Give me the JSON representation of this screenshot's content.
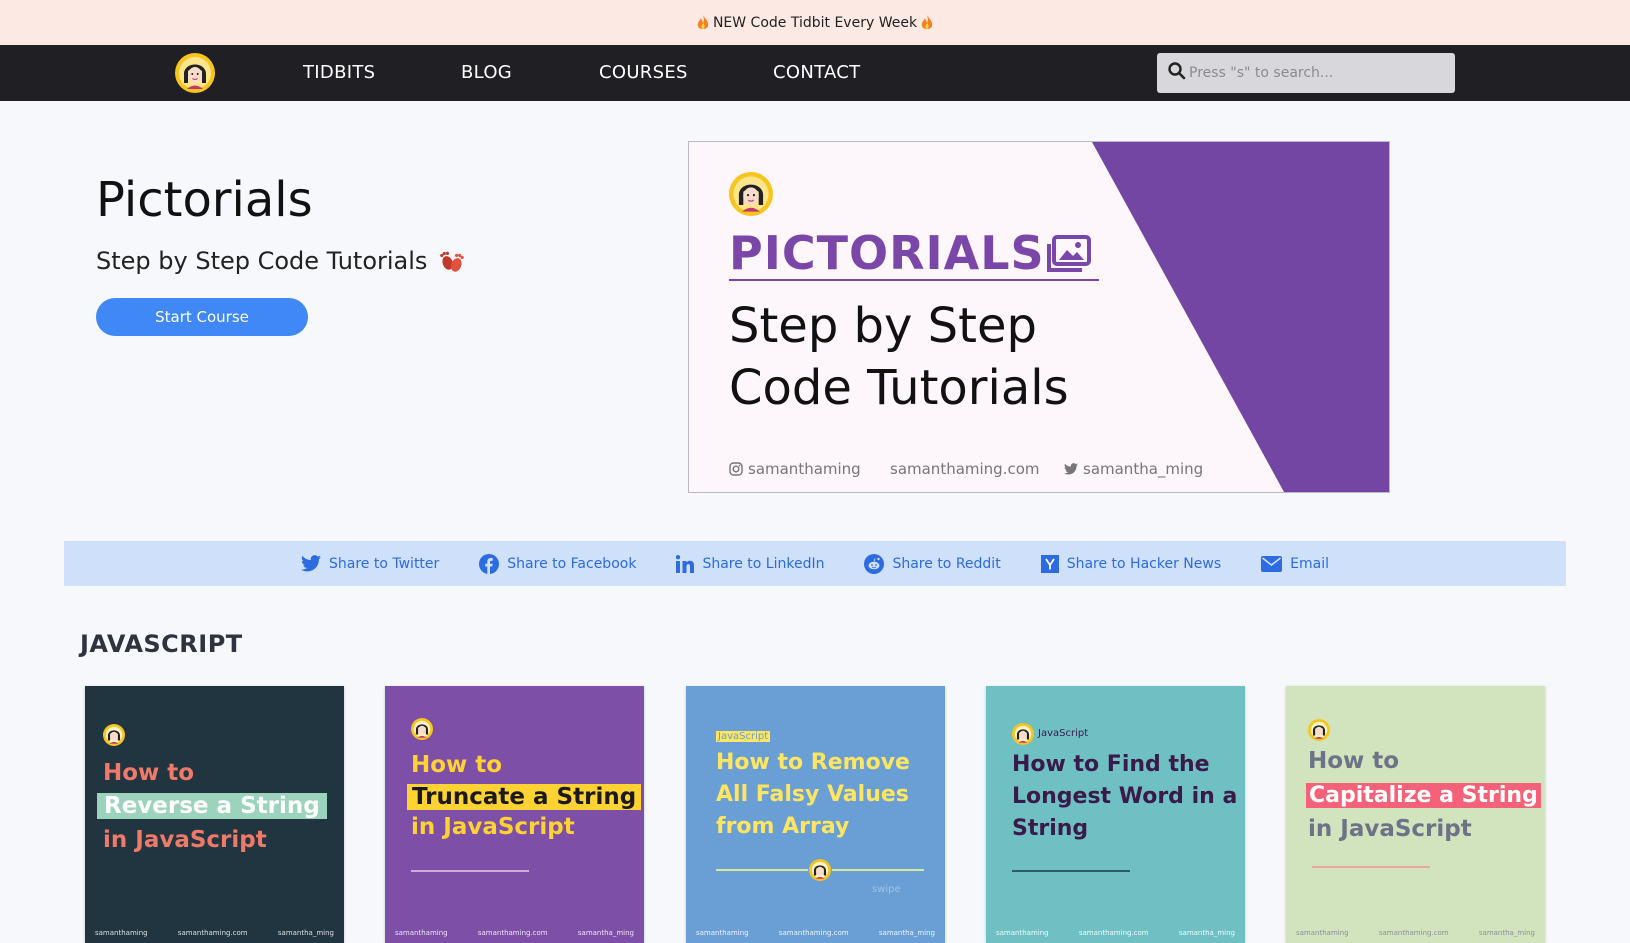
{
  "announcement": {
    "text": "NEW Code Tidbit Every Week"
  },
  "nav": {
    "links": [
      "TIDBITS",
      "BLOG",
      "COURSES",
      "CONTACT"
    ],
    "search_placeholder": "Press \"s\" to search..."
  },
  "hero": {
    "title": "Pictorials",
    "subtitle": "Step by Step Code Tutorials",
    "button": "Start Course",
    "banner": {
      "word": "PICTORIALS",
      "headline_line1": "Step by Step",
      "headline_line2": "Code Tutorials",
      "footer": {
        "instagram": "samanthaming",
        "website": "samanthaming.com",
        "twitter": "samantha_ming"
      },
      "colors": {
        "background": "#fdf6fb",
        "accent": "#7446a4"
      }
    }
  },
  "share": {
    "items": [
      {
        "label": "Share to Twitter",
        "icon": "twitter-icon"
      },
      {
        "label": "Share to Facebook",
        "icon": "facebook-icon"
      },
      {
        "label": "Share to LinkedIn",
        "icon": "linkedin-icon"
      },
      {
        "label": "Share to Reddit",
        "icon": "reddit-icon"
      },
      {
        "label": "Share to Hacker News",
        "icon": "hackernews-icon"
      },
      {
        "label": "Email",
        "icon": "email-icon"
      }
    ],
    "color": "#2c6be0",
    "background": "#cfe0fb"
  },
  "section": {
    "title": "JAVASCRIPT"
  },
  "cards": [
    {
      "lines": [
        "How to",
        "Reverse a String",
        "in JavaScript"
      ],
      "bg": "#213540",
      "text": "#f07a6a",
      "highlight": "#9bd3bd",
      "highlight_text": "#ffffff"
    },
    {
      "lines": [
        "How to",
        "Truncate a String",
        "in JavaScript"
      ],
      "bg": "#7d4fa7",
      "text": "#ffd234",
      "highlight": "#ffd234",
      "highlight_text": "#1a1a1a"
    },
    {
      "tag": "JavaScript",
      "lines": [
        "How to Remove",
        "All Falsy Values",
        "from Array"
      ],
      "swipe": "swipe",
      "bg": "#6a9fd6",
      "text": "#ffe560"
    },
    {
      "tag": "JavaScript",
      "lines": [
        "How to Find the",
        "Longest Word in a",
        "String"
      ],
      "bg": "#6ec0c2",
      "text": "#3a1a4a"
    },
    {
      "lines": [
        "How to",
        "Capitalize a String",
        "in JavaScript"
      ],
      "bg": "#d2e4bd",
      "text": "#6c7288",
      "highlight": "#f4627a",
      "highlight_text": "#ffffff"
    }
  ],
  "card_footer": {
    "instagram": "samanthaming",
    "website": "samanthaming.com",
    "twitter": "samantha_ming"
  }
}
